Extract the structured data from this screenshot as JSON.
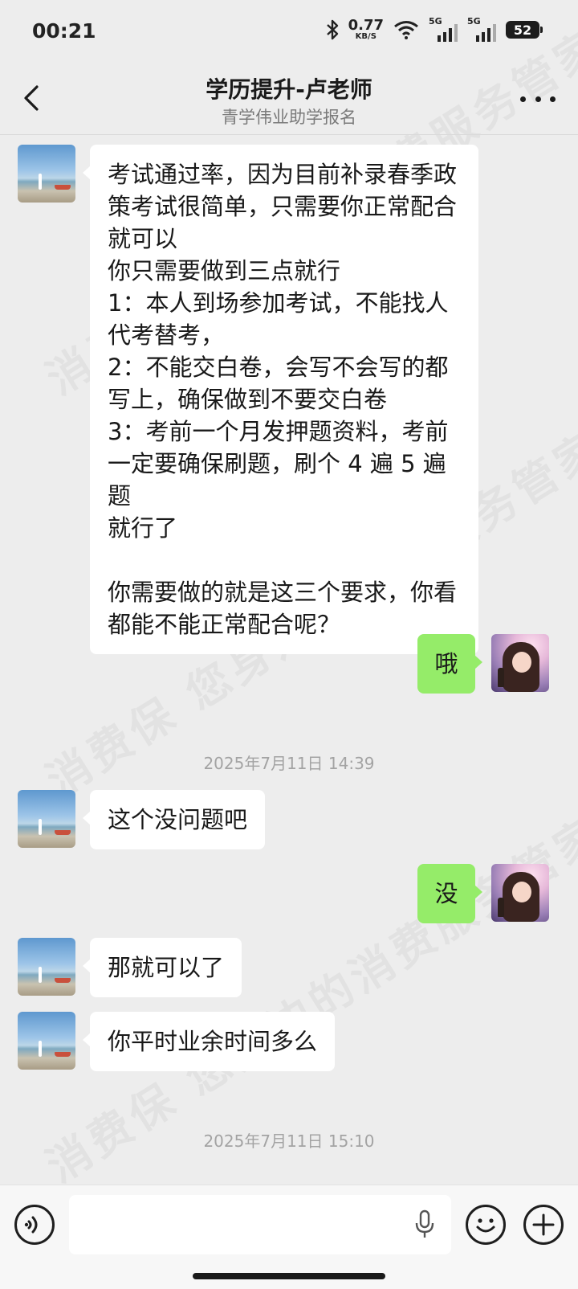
{
  "status_bar": {
    "time": "00:21",
    "net_speed": "0.77",
    "net_speed_unit": "KB/S",
    "signal_1_label": "5G",
    "signal_2_label": "5G",
    "battery": "52",
    "icons": [
      "bluetooth-icon",
      "wifi-icon",
      "signal-icon",
      "signal-icon",
      "battery-icon"
    ]
  },
  "header": {
    "title": "学历提升-卢老师",
    "subtitle": "青学伟业助学报名",
    "back_icon": "chevron-left-icon",
    "more_icon": "more-icon"
  },
  "messages": [
    {
      "sender": "other",
      "text": "考试通过率，因为目前补录春季政\n策考试很简单，只需要你正常配合\n就可以\n你只需要做到三点就行\n1：本人到场参加考试，不能找人\n代考替考，\n2：不能交白卷，会写不会写的都\n写上，确保做到不要交白卷\n3：考前一个月发押题资料，考前\n一定要确保刷题，刷个 4 遍 5 遍题\n就行了\n\n你需要做的就是这三个要求，你看\n都能不能正常配合呢？"
    },
    {
      "sender": "me",
      "text": "哦"
    },
    {
      "type": "time",
      "text": "2025年7月11日 14:39"
    },
    {
      "sender": "other",
      "text": "这个没问题吧"
    },
    {
      "sender": "me",
      "text": "没"
    },
    {
      "sender": "other",
      "text": "那就可以了"
    },
    {
      "sender": "other",
      "text": "你平时业余时间多么"
    },
    {
      "type": "time",
      "text": "2025年7月11日 15:10"
    }
  ],
  "watermark": {
    "line_1": "消费保 您身边的消费服务管家",
    "line_2": "消费保 您身边的消费服务管家",
    "line_3": "消费保 您身边的消费服务管家"
  },
  "input_bar": {
    "placeholder": "",
    "icons": [
      "voice-icon",
      "mic-icon",
      "emoji-icon",
      "plus-icon"
    ]
  },
  "colors": {
    "background": "#ededed",
    "my_bubble": "#95ec69",
    "other_bubble": "#ffffff"
  }
}
